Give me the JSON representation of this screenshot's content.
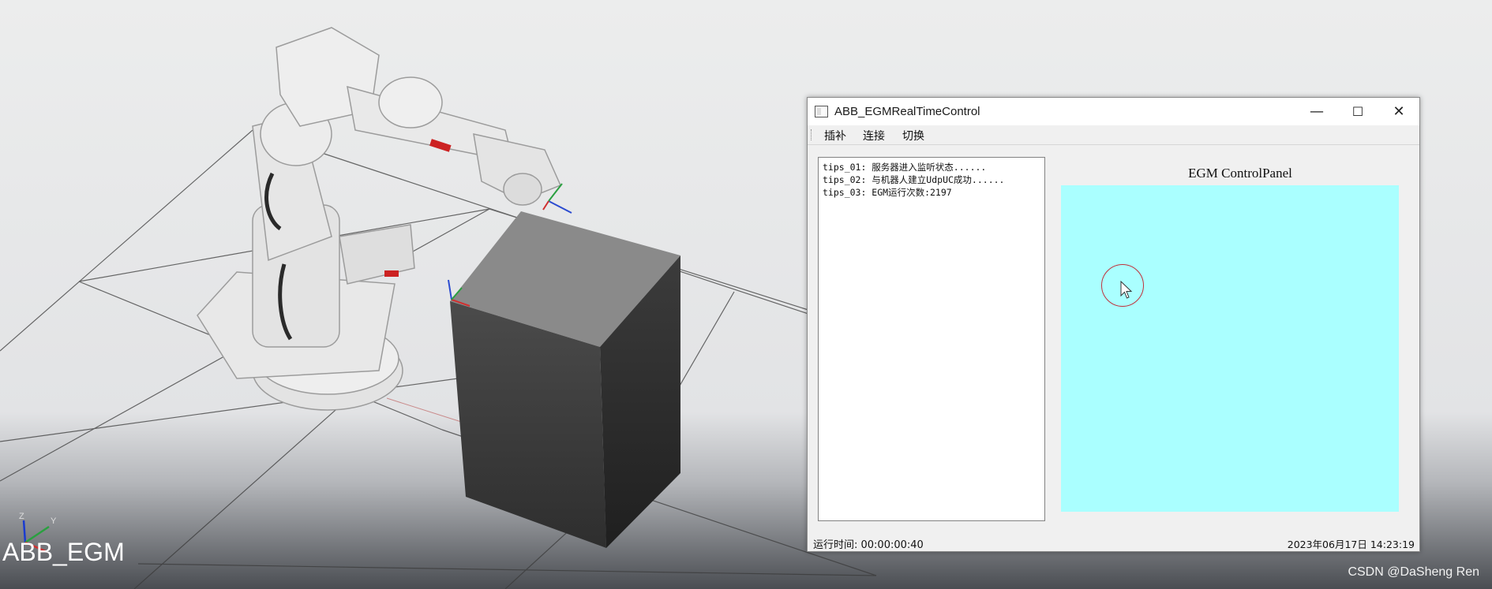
{
  "scene": {
    "label": "ABB_EGM",
    "watermark": "CSDN @DaSheng Ren",
    "axis_labels": {
      "z": "Z",
      "y": "Y"
    }
  },
  "window": {
    "title": "ABB_EGMRealTimeControl",
    "buttons": {
      "minimize": "—",
      "maximize": "☐",
      "close": "✕"
    },
    "menu": [
      "插补",
      "连接",
      "切换"
    ],
    "log_lines": [
      "tips_01: 服务器进入监听状态......",
      "tips_02: 与机器人建立UdpUC成功......",
      "tips_03: EGM运行次数:2197"
    ],
    "panel_title": "EGM  ControlPanel",
    "panel_color": "#aaffff",
    "status_left": "运行时间: 00:00:00:40",
    "status_right": "2023年06月17日  14:23:19"
  }
}
